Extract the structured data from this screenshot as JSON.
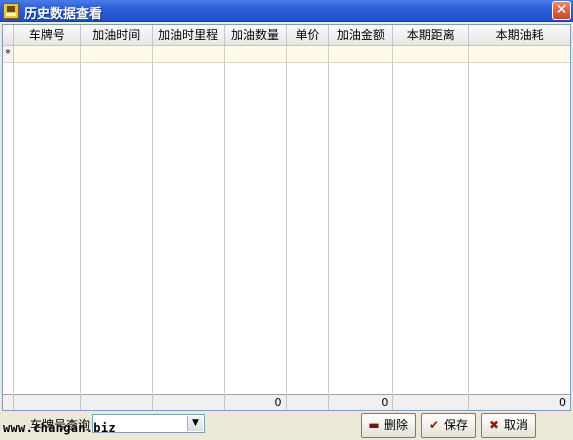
{
  "window": {
    "title": "历史数据查看",
    "close_glyph": "✕"
  },
  "grid": {
    "columns": [
      {
        "label": "车牌号",
        "total": ""
      },
      {
        "label": "加油时间",
        "total": ""
      },
      {
        "label": "加油时里程",
        "total": ""
      },
      {
        "label": "加油数量",
        "total": "0"
      },
      {
        "label": "单价",
        "total": ""
      },
      {
        "label": "加油金额",
        "total": "0"
      },
      {
        "label": "本期距离",
        "total": ""
      },
      {
        "label": "本期油耗",
        "total": "0"
      }
    ],
    "new_row_marker": "*"
  },
  "footer": {
    "search_label": "车牌号查询",
    "plate_select_value": "",
    "combo_arrow": "▼",
    "watermark": "www.changan.biz",
    "buttons": {
      "delete": {
        "label": "删除",
        "icon": "minus-icon",
        "glyph": "▬",
        "color": "#6a1b10"
      },
      "save": {
        "label": "保存",
        "icon": "check-icon",
        "glyph": "✔",
        "color": "#8a1c10"
      },
      "cancel": {
        "label": "取消",
        "icon": "x-icon",
        "glyph": "✖",
        "color": "#8a1c10"
      }
    }
  }
}
